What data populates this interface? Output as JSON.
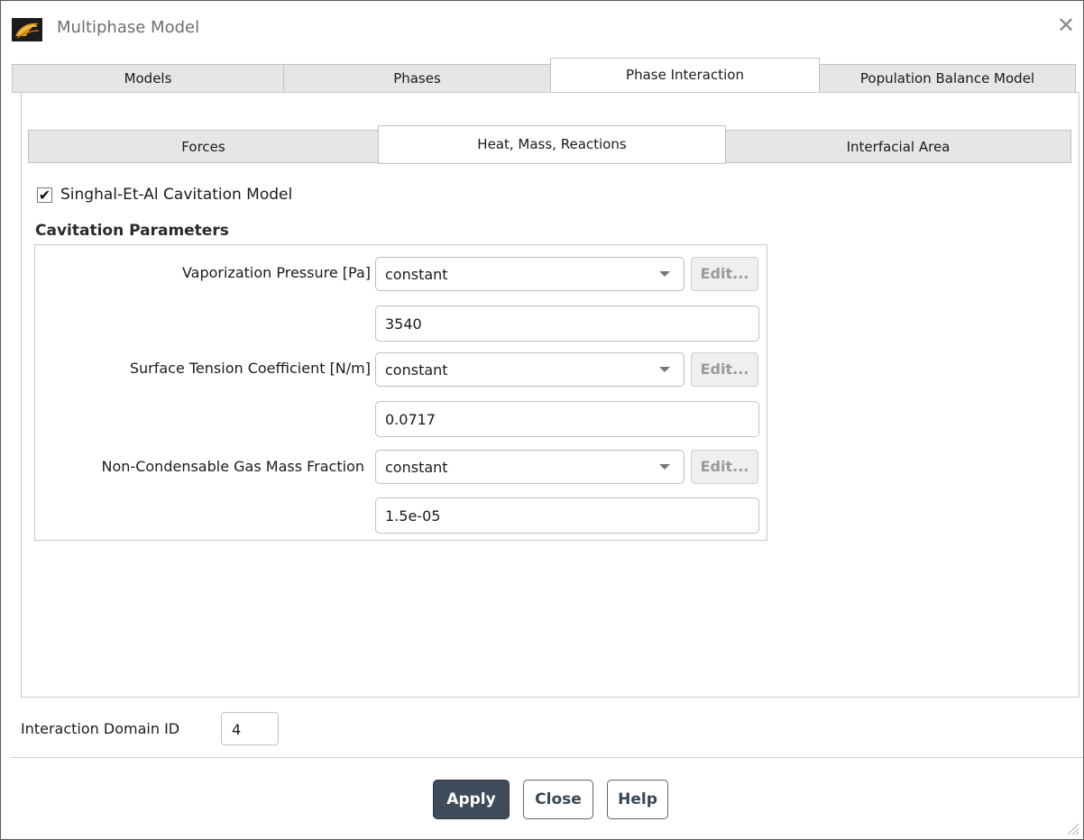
{
  "window": {
    "title": "Multiphase Model",
    "close_symbol": "✕"
  },
  "main_tabs": [
    {
      "label": "Models",
      "active": false
    },
    {
      "label": "Phases",
      "active": false
    },
    {
      "label": "Phase Interaction",
      "active": true
    },
    {
      "label": "Population Balance Model",
      "active": false
    }
  ],
  "sub_tabs": [
    {
      "label": "Forces",
      "active": false
    },
    {
      "label": "Heat, Mass, Reactions",
      "active": true
    },
    {
      "label": "Interfacial Area",
      "active": false
    }
  ],
  "cavitation_model": {
    "label": "Singhal-Et-Al Cavitation Model",
    "checked": true,
    "check_glyph": "✔"
  },
  "cavitation_parameters": {
    "title": "Cavitation Parameters",
    "rows": [
      {
        "label": "Vaporization Pressure [Pa]",
        "method": "constant",
        "edit_label": "Edit...",
        "value": "3540"
      },
      {
        "label": "Surface Tension Coefficient [N/m]",
        "method": "constant",
        "edit_label": "Edit...",
        "value": "0.0717"
      },
      {
        "label": "Non-Condensable Gas Mass Fraction",
        "method": "constant",
        "edit_label": "Edit...",
        "value": "1.5e-05"
      }
    ]
  },
  "interaction_domain": {
    "label": "Interaction Domain ID",
    "value": "4"
  },
  "buttons": {
    "apply": "Apply",
    "close": "Close",
    "help": "Help"
  },
  "colors": {
    "apply_bg": "#3f4b5a",
    "tab_inactive": "#e6e6e6",
    "border": "#c2c2c2"
  }
}
